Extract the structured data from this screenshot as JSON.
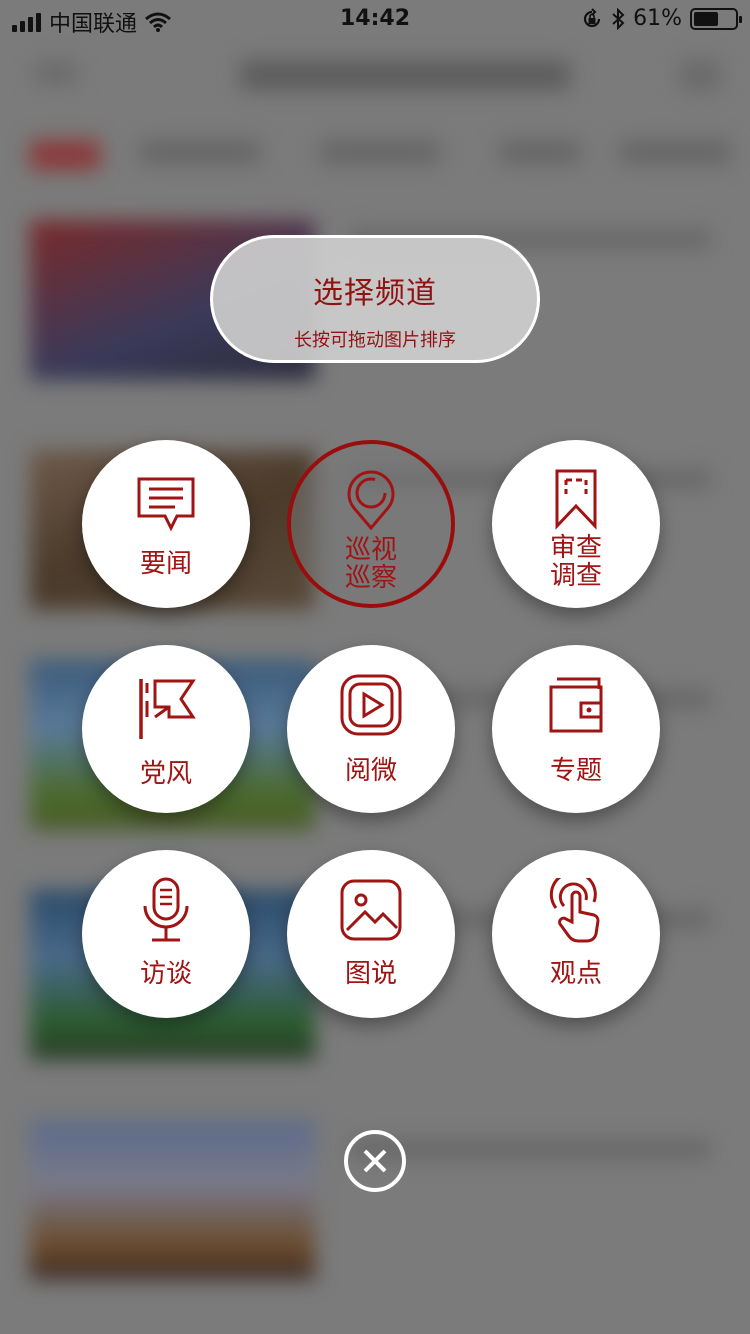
{
  "status_bar": {
    "carrier": "中国联通",
    "time": "14:42",
    "battery": "61%",
    "battery_level": 0.61
  },
  "header": {
    "title": "选择频道",
    "subtitle": "长按可拖动图片排序"
  },
  "channels": [
    {
      "label": "要闻",
      "icon": "news-chat-icon",
      "active": false
    },
    {
      "label": "巡视巡察",
      "icon": "location-pin-icon",
      "active": true
    },
    {
      "label": "审查调查",
      "icon": "bookmark-icon",
      "active": false
    },
    {
      "label": "党风",
      "icon": "flag-icon",
      "active": false
    },
    {
      "label": "阅微",
      "icon": "video-play-icon",
      "active": false
    },
    {
      "label": "专题",
      "icon": "wallet-icon",
      "active": false
    },
    {
      "label": "访谈",
      "icon": "microphone-icon",
      "active": false
    },
    {
      "label": "图说",
      "icon": "image-icon",
      "active": false
    },
    {
      "label": "观点",
      "icon": "touch-hand-icon",
      "active": false
    }
  ],
  "colors": {
    "accent": "#a01414",
    "overlay": "#7d7d7d"
  }
}
